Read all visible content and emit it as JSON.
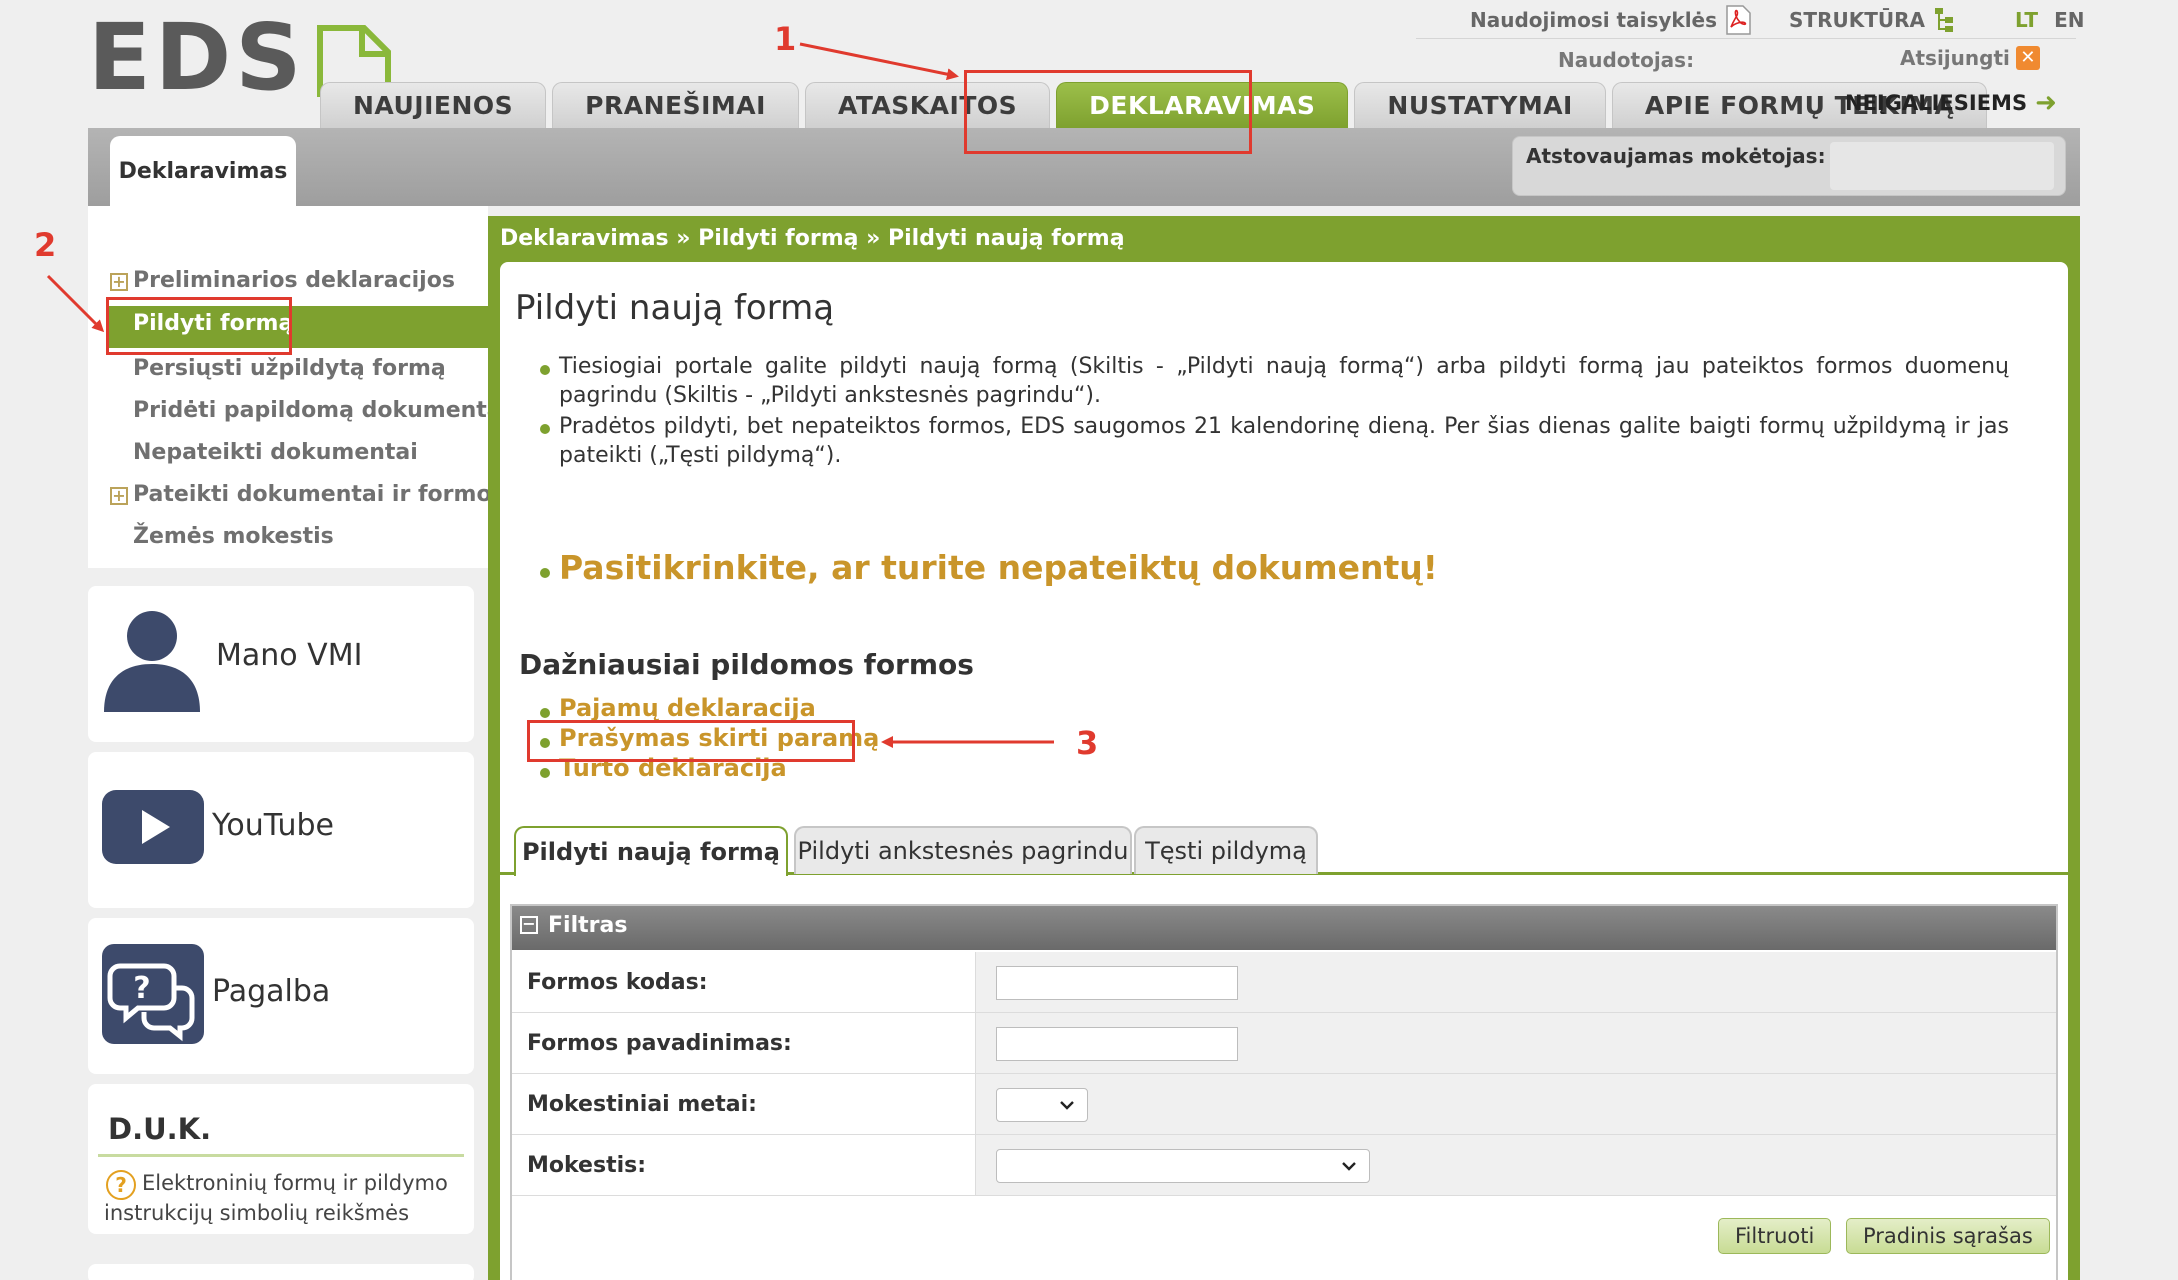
{
  "logo": {
    "text": "EDS"
  },
  "top_links": {
    "rules": "Naudojimosi taisyklės",
    "structure": "STRUKTŪRA",
    "lang_lt": "LT",
    "lang_en": "EN",
    "user_label": "Naudotojas:",
    "logout": "Atsijungti"
  },
  "nav": {
    "tabs": [
      {
        "label": "NAUJIENOS"
      },
      {
        "label": "PRANEŠIMAI"
      },
      {
        "label": "ATASKAITOS"
      },
      {
        "label": "DEKLARAVIMAS",
        "active": true
      },
      {
        "label": "NUSTATYMAI"
      },
      {
        "label": "APIE FORMŲ TEIKIMĄ"
      }
    ],
    "special": "NEĮGALIESIEMS"
  },
  "subbar": {
    "tab": "Deklaravimas",
    "payer_label": "Atstovaujamas mokėtojas:"
  },
  "sidebar": {
    "items": [
      {
        "label": "Preliminarios deklaracijos",
        "expandable": true
      },
      {
        "label": "Pildyti formą",
        "active": true
      },
      {
        "label": "Persiųsti užpildytą formą"
      },
      {
        "label": "Pridėti papildomą dokumentą"
      },
      {
        "label": "Nepateikti dokumentai"
      },
      {
        "label": "Pateikti dokumentai ir formos",
        "expandable": true
      },
      {
        "label": "Žemės mokestis"
      }
    ],
    "expand_symbol": "+",
    "cards": {
      "mano_vmi": "Mano VMI",
      "youtube": "YouTube",
      "pagalba": "Pagalba"
    },
    "duk": {
      "title": "D.U.K.",
      "q_symbol": "?",
      "text": "Elektroninių formų ir pildymo instrukcijų simbolių reikšmės"
    }
  },
  "main": {
    "breadcrumb": "Deklaravimas » Pildyti formą » Pildyti naują formą",
    "title": "Pildyti naują formą",
    "info": [
      "Tiesiogiai portale galite pildyti naują formą (Skiltis - „Pildyti naują formą“) arba pildyti formą jau pateiktos formos duomenų pagrindu (Skiltis - „Pildyti ankstesnės pagrindu“).",
      "Pradėtos pildyti, bet nepateiktos formos, EDS saugomos 21 kalendorinę dieną. Per šias dienas galite baigti formų užpildymą ir jas pateikti („Tęsti pildymą“)."
    ],
    "warning": "Pasitikrinkite, ar turite nepateiktų dokumentų!",
    "frequent_title": "Dažniausiai pildomos formos",
    "frequent_links": [
      "Pajamų deklaracija",
      "Prašymas skirti paramą",
      "Turto deklaracija"
    ],
    "form_tabs": [
      {
        "label": "Pildyti naują formą",
        "active": true
      },
      {
        "label": "Pildyti ankstesnės pagrindu"
      },
      {
        "label": "Tęsti pildymą"
      }
    ],
    "filter": {
      "title": "Filtras",
      "toggle_symbol": "−",
      "rows": [
        {
          "label": "Formos kodas:",
          "value": ""
        },
        {
          "label": "Formos pavadinimas:",
          "value": ""
        },
        {
          "label": "Mokestiniai metai:",
          "value": ""
        },
        {
          "label": "Mokestis:",
          "value": ""
        }
      ],
      "buttons": {
        "filter": "Filtruoti",
        "reset": "Pradinis sąrašas"
      }
    }
  },
  "annotations": {
    "step1": "1",
    "step2": "2",
    "step3": "3",
    "color": "#e03a2e"
  },
  "colors": {
    "accent": "#7ea12f",
    "link": "#c9952a",
    "nav_active": "#7ea12f"
  },
  "icons": [
    "pdf-icon",
    "structure-icon",
    "logout-icon",
    "arrow-right-icon",
    "plus-box-icon",
    "user-icon",
    "youtube-icon",
    "help-chat-icon",
    "question-icon",
    "chevron-down-icon",
    "minus-box-icon"
  ]
}
